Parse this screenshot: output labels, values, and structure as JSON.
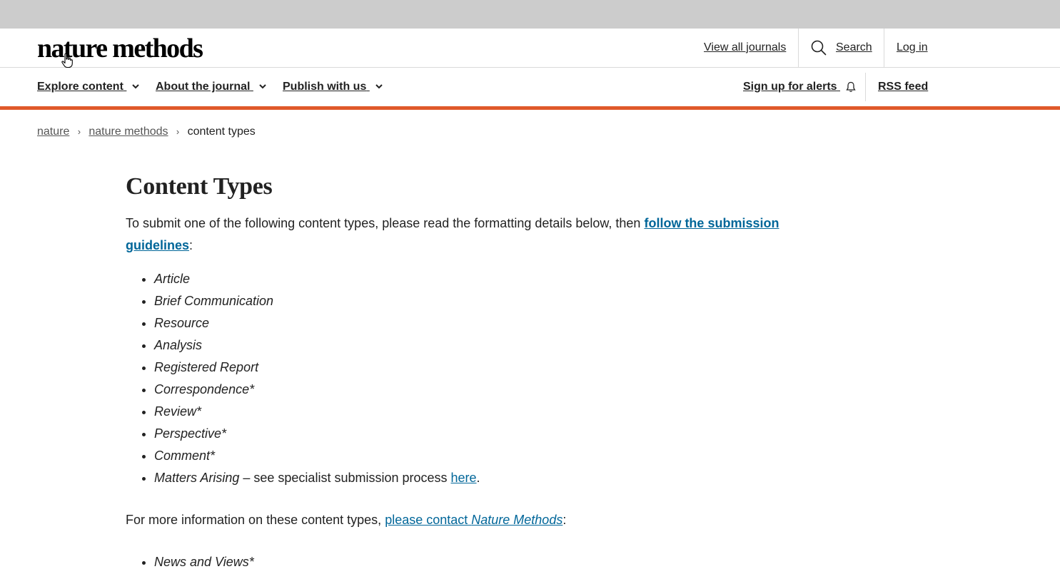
{
  "header": {
    "logo_text": "nature methods",
    "view_all_journals": "View all journals",
    "search_label": "Search",
    "login_label": "Log in"
  },
  "nav": {
    "items": [
      {
        "label": "Explore content"
      },
      {
        "label": "About the journal"
      },
      {
        "label": "Publish with us"
      }
    ],
    "alerts_label": "Sign up for alerts",
    "rss_label": "RSS feed"
  },
  "breadcrumb": {
    "items": [
      "nature",
      "nature methods"
    ],
    "current": "content types",
    "separator": "›"
  },
  "main": {
    "title": "Content Types",
    "intro_text": "To submit one of the following content types, please read the formatting details below, then ",
    "intro_link": "follow the submission guidelines",
    "intro_end": ":",
    "content_types": [
      "Article",
      "Brief Communication",
      "Resource",
      "Analysis",
      "Registered Report",
      "Correspondence*",
      "Review*",
      "Perspective*",
      "Comment*"
    ],
    "matters_arising": {
      "label": "Matters Arising",
      "text": " – see specialist submission process ",
      "link": "here",
      "end": "."
    },
    "more_info_text": "For more information on these content types, ",
    "more_info_link_a": "please contact ",
    "more_info_link_b": "Nature Methods",
    "more_info_end": ":",
    "contact_types": [
      "News and Views*"
    ]
  },
  "colors": {
    "accent_orange": "#e0592a",
    "link_blue": "#006699",
    "top_bar_gray": "#cccccc"
  },
  "icons": [
    "search-icon",
    "chevron-down-icon",
    "bell-icon",
    "chevron-right-icon",
    "hand-cursor-icon"
  ]
}
